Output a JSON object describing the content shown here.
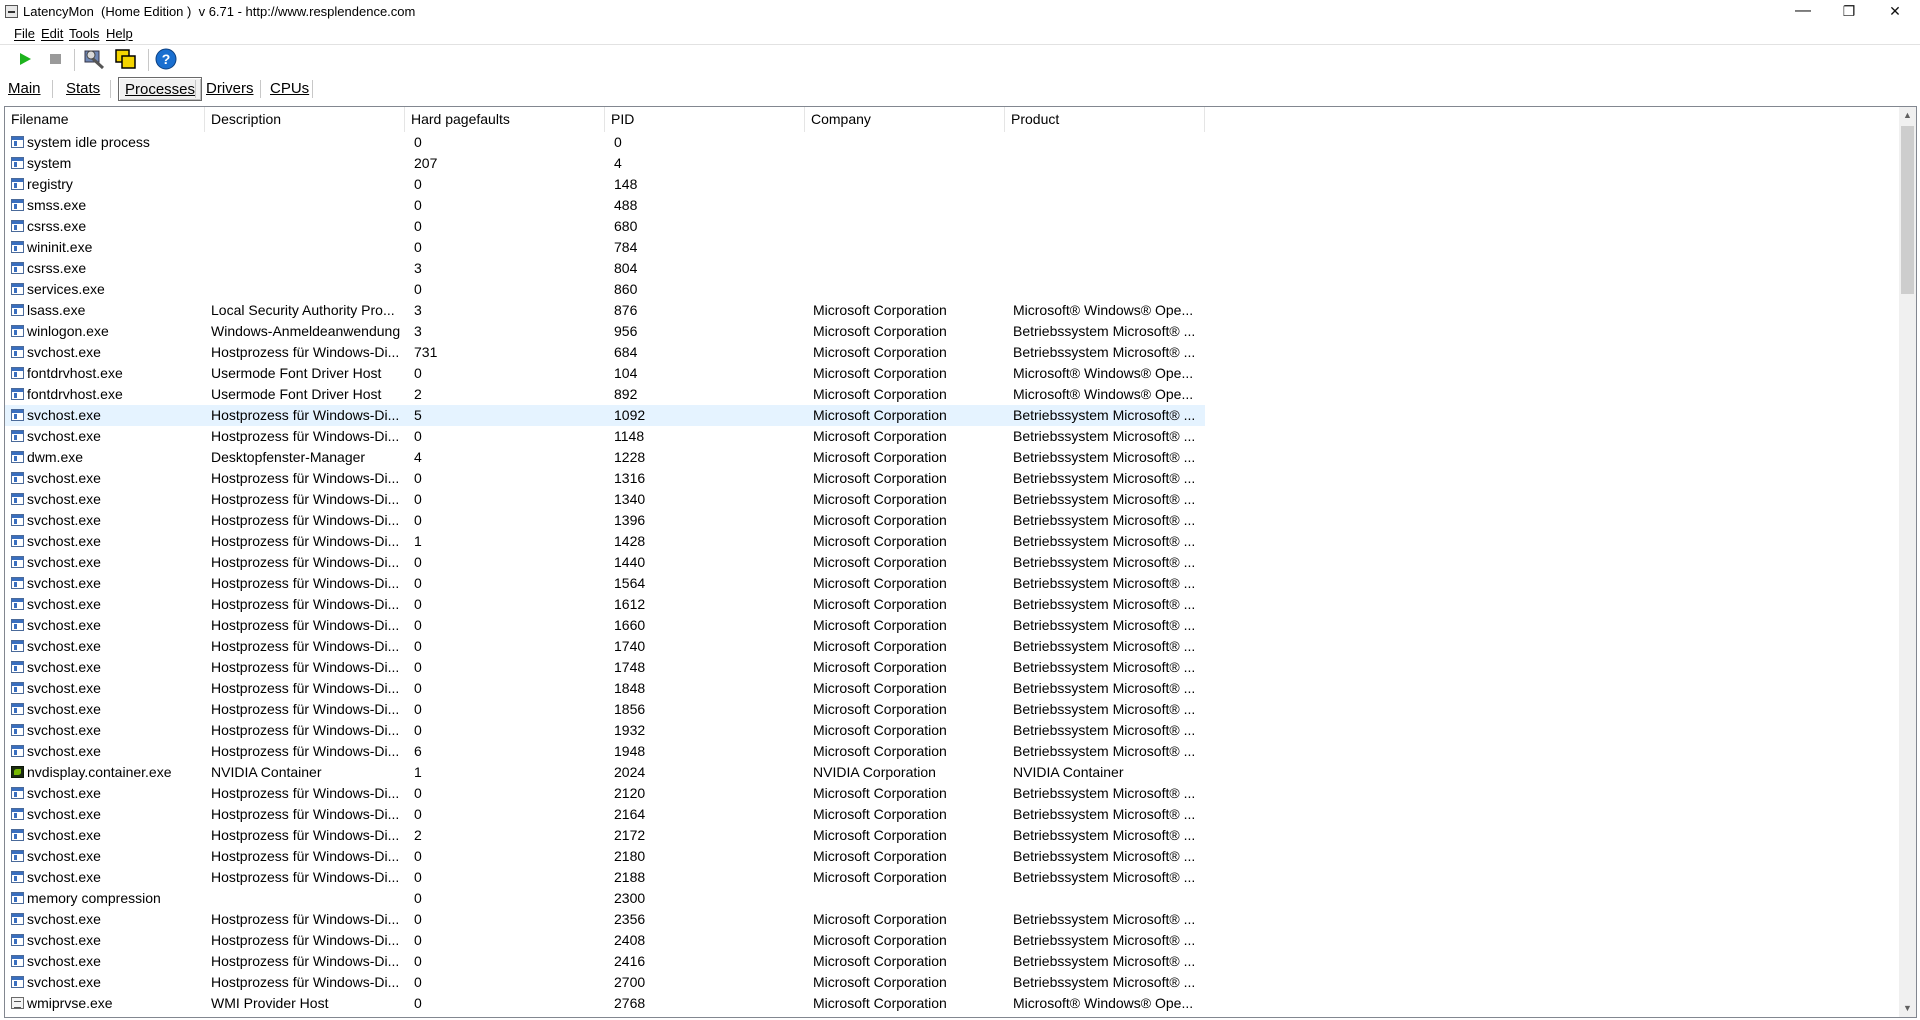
{
  "window": {
    "title": "LatencyMon  (Home Edition )  v 6.71 - http://www.resplendence.com",
    "minimize": "—",
    "maximize": "❐",
    "close": "✕"
  },
  "menu": {
    "file": "File",
    "edit": "Edit",
    "tools": "Tools",
    "help": "Help"
  },
  "toolbar": {
    "start_icon": "play-icon",
    "stop_icon": "stop-icon",
    "tools_icon": "tools-icon",
    "windows_icon": "windows-icon",
    "help_icon": "help-icon",
    "help_glyph": "?"
  },
  "tabs": {
    "main": "Main",
    "stats": "Stats",
    "processes": "Processes",
    "drivers": "Drivers",
    "cpus": "CPUs",
    "active": "Processes"
  },
  "columns": [
    "Filename",
    "Description",
    "Hard pagefaults",
    "PID",
    "Company",
    "Product"
  ],
  "rows": [
    [
      "system idle process",
      "",
      "0",
      "0",
      "",
      ""
    ],
    [
      "system",
      "",
      "207",
      "4",
      "",
      ""
    ],
    [
      "registry",
      "",
      "0",
      "148",
      "",
      ""
    ],
    [
      "smss.exe",
      "",
      "0",
      "488",
      "",
      ""
    ],
    [
      "csrss.exe",
      "",
      "0",
      "680",
      "",
      ""
    ],
    [
      "wininit.exe",
      "",
      "0",
      "784",
      "",
      ""
    ],
    [
      "csrss.exe",
      "",
      "3",
      "804",
      "",
      ""
    ],
    [
      "services.exe",
      "",
      "0",
      "860",
      "",
      ""
    ],
    [
      "lsass.exe",
      "Local Security Authority Pro...",
      "3",
      "876",
      "Microsoft Corporation",
      "Microsoft® Windows® Ope..."
    ],
    [
      "winlogon.exe",
      "Windows-Anmeldeanwendung",
      "3",
      "956",
      "Microsoft Corporation",
      "Betriebssystem Microsoft® ..."
    ],
    [
      "svchost.exe",
      "Hostprozess für Windows-Di...",
      "731",
      "684",
      "Microsoft Corporation",
      "Betriebssystem Microsoft® ..."
    ],
    [
      "fontdrvhost.exe",
      "Usermode Font Driver Host",
      "0",
      "104",
      "Microsoft Corporation",
      "Microsoft® Windows® Ope..."
    ],
    [
      "fontdrvhost.exe",
      "Usermode Font Driver Host",
      "2",
      "892",
      "Microsoft Corporation",
      "Microsoft® Windows® Ope..."
    ],
    [
      "svchost.exe",
      "Hostprozess für Windows-Di...",
      "5",
      "1092",
      "Microsoft Corporation",
      "Betriebssystem Microsoft® ..."
    ],
    [
      "svchost.exe",
      "Hostprozess für Windows-Di...",
      "0",
      "1148",
      "Microsoft Corporation",
      "Betriebssystem Microsoft® ..."
    ],
    [
      "dwm.exe",
      "Desktopfenster-Manager",
      "4",
      "1228",
      "Microsoft Corporation",
      "Betriebssystem Microsoft® ..."
    ],
    [
      "svchost.exe",
      "Hostprozess für Windows-Di...",
      "0",
      "1316",
      "Microsoft Corporation",
      "Betriebssystem Microsoft® ..."
    ],
    [
      "svchost.exe",
      "Hostprozess für Windows-Di...",
      "0",
      "1340",
      "Microsoft Corporation",
      "Betriebssystem Microsoft® ..."
    ],
    [
      "svchost.exe",
      "Hostprozess für Windows-Di...",
      "0",
      "1396",
      "Microsoft Corporation",
      "Betriebssystem Microsoft® ..."
    ],
    [
      "svchost.exe",
      "Hostprozess für Windows-Di...",
      "1",
      "1428",
      "Microsoft Corporation",
      "Betriebssystem Microsoft® ..."
    ],
    [
      "svchost.exe",
      "Hostprozess für Windows-Di...",
      "0",
      "1440",
      "Microsoft Corporation",
      "Betriebssystem Microsoft® ..."
    ],
    [
      "svchost.exe",
      "Hostprozess für Windows-Di...",
      "0",
      "1564",
      "Microsoft Corporation",
      "Betriebssystem Microsoft® ..."
    ],
    [
      "svchost.exe",
      "Hostprozess für Windows-Di...",
      "0",
      "1612",
      "Microsoft Corporation",
      "Betriebssystem Microsoft® ..."
    ],
    [
      "svchost.exe",
      "Hostprozess für Windows-Di...",
      "0",
      "1660",
      "Microsoft Corporation",
      "Betriebssystem Microsoft® ..."
    ],
    [
      "svchost.exe",
      "Hostprozess für Windows-Di...",
      "0",
      "1740",
      "Microsoft Corporation",
      "Betriebssystem Microsoft® ..."
    ],
    [
      "svchost.exe",
      "Hostprozess für Windows-Di...",
      "0",
      "1748",
      "Microsoft Corporation",
      "Betriebssystem Microsoft® ..."
    ],
    [
      "svchost.exe",
      "Hostprozess für Windows-Di...",
      "0",
      "1848",
      "Microsoft Corporation",
      "Betriebssystem Microsoft® ..."
    ],
    [
      "svchost.exe",
      "Hostprozess für Windows-Di...",
      "0",
      "1856",
      "Microsoft Corporation",
      "Betriebssystem Microsoft® ..."
    ],
    [
      "svchost.exe",
      "Hostprozess für Windows-Di...",
      "0",
      "1932",
      "Microsoft Corporation",
      "Betriebssystem Microsoft® ..."
    ],
    [
      "svchost.exe",
      "Hostprozess für Windows-Di...",
      "6",
      "1948",
      "Microsoft Corporation",
      "Betriebssystem Microsoft® ..."
    ],
    [
      "nvdisplay.container.exe",
      "NVIDIA Container",
      "1",
      "2024",
      "NVIDIA Corporation",
      "NVIDIA Container"
    ],
    [
      "svchost.exe",
      "Hostprozess für Windows-Di...",
      "0",
      "2120",
      "Microsoft Corporation",
      "Betriebssystem Microsoft® ..."
    ],
    [
      "svchost.exe",
      "Hostprozess für Windows-Di...",
      "0",
      "2164",
      "Microsoft Corporation",
      "Betriebssystem Microsoft® ..."
    ],
    [
      "svchost.exe",
      "Hostprozess für Windows-Di...",
      "2",
      "2172",
      "Microsoft Corporation",
      "Betriebssystem Microsoft® ..."
    ],
    [
      "svchost.exe",
      "Hostprozess für Windows-Di...",
      "0",
      "2180",
      "Microsoft Corporation",
      "Betriebssystem Microsoft® ..."
    ],
    [
      "svchost.exe",
      "Hostprozess für Windows-Di...",
      "0",
      "2188",
      "Microsoft Corporation",
      "Betriebssystem Microsoft® ..."
    ],
    [
      "memory compression",
      "",
      "0",
      "2300",
      "",
      ""
    ],
    [
      "svchost.exe",
      "Hostprozess für Windows-Di...",
      "0",
      "2356",
      "Microsoft Corporation",
      "Betriebssystem Microsoft® ..."
    ],
    [
      "svchost.exe",
      "Hostprozess für Windows-Di...",
      "0",
      "2408",
      "Microsoft Corporation",
      "Betriebssystem Microsoft® ..."
    ],
    [
      "svchost.exe",
      "Hostprozess für Windows-Di...",
      "0",
      "2416",
      "Microsoft Corporation",
      "Betriebssystem Microsoft® ..."
    ],
    [
      "svchost.exe",
      "Hostprozess für Windows-Di...",
      "0",
      "2700",
      "Microsoft Corporation",
      "Betriebssystem Microsoft® ..."
    ],
    [
      "wmiprvse.exe",
      "WMI Provider Host",
      "0",
      "2768",
      "Microsoft Corporation",
      "Microsoft® Windows® Ope..."
    ]
  ],
  "row_icons": [
    "window-process-icon",
    "window-process-icon",
    "window-process-icon",
    "window-process-icon",
    "window-process-icon",
    "window-process-icon",
    "window-process-icon",
    "window-process-icon",
    "window-process-icon",
    "window-process-icon",
    "window-process-icon",
    "window-process-icon",
    "window-process-icon",
    "window-process-icon",
    "window-process-icon",
    "window-process-icon",
    "window-process-icon",
    "window-process-icon",
    "window-process-icon",
    "window-process-icon",
    "window-process-icon",
    "window-process-icon",
    "window-process-icon",
    "window-process-icon",
    "window-process-icon",
    "window-process-icon",
    "window-process-icon",
    "window-process-icon",
    "window-process-icon",
    "window-process-icon",
    "nvidia-icon",
    "window-process-icon",
    "window-process-icon",
    "window-process-icon",
    "window-process-icon",
    "window-process-icon",
    "window-process-icon",
    "window-process-icon",
    "window-process-icon",
    "window-process-icon",
    "window-process-icon",
    "wmi-provider-icon"
  ],
  "selected_row_index": 13,
  "colors": {
    "selection": "#e5f3ff",
    "frame": "#828790",
    "play": "#1db31d",
    "help": "#1a6fd0"
  },
  "scrollbar": {
    "up_glyph": "▲",
    "down_glyph": "▼"
  }
}
